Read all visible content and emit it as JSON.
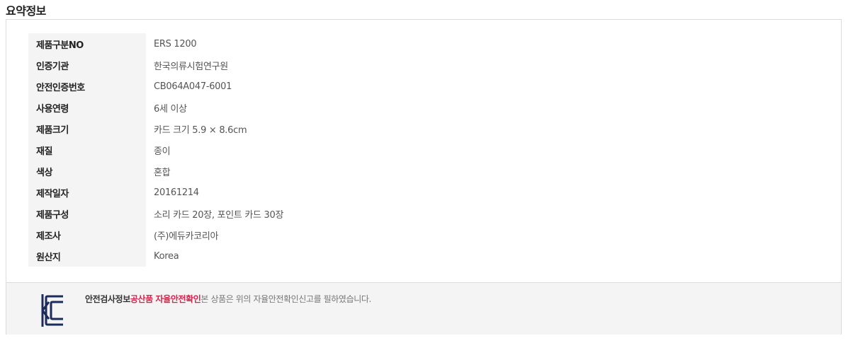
{
  "section": {
    "title": "요약정보"
  },
  "spec_rows": [
    {
      "label": "제품구분NO",
      "value": "ERS 1200"
    },
    {
      "label": "인증기관",
      "value": "한국의류시험연구원"
    },
    {
      "label": "안전인증번호",
      "value": "CB064A047-6001"
    },
    {
      "label": "사용연령",
      "value": "6세 이상"
    },
    {
      "label": "제품크기",
      "value": "카드 크기 5.9 × 8.6cm"
    },
    {
      "label": "재질",
      "value": "종이"
    },
    {
      "label": "색상",
      "value": "혼합"
    },
    {
      "label": "제작일자",
      "value": "20161214"
    },
    {
      "label": "제품구성",
      "value": "소리 카드 20장, 포인트 카드 30장"
    },
    {
      "label": "제조사",
      "value": "(주)에듀카코리아"
    },
    {
      "label": "원산지",
      "value": "Korea"
    }
  ],
  "safety": {
    "logo_icon": "kc-certification-icon",
    "label": "안전검사정보",
    "status": "공산품 자율안전확인",
    "description": "본 상품은 위의 자율안전확인신고를 필하였습니다.",
    "accent_color": "#d1264c",
    "logo_color": "#1d2a5c"
  }
}
